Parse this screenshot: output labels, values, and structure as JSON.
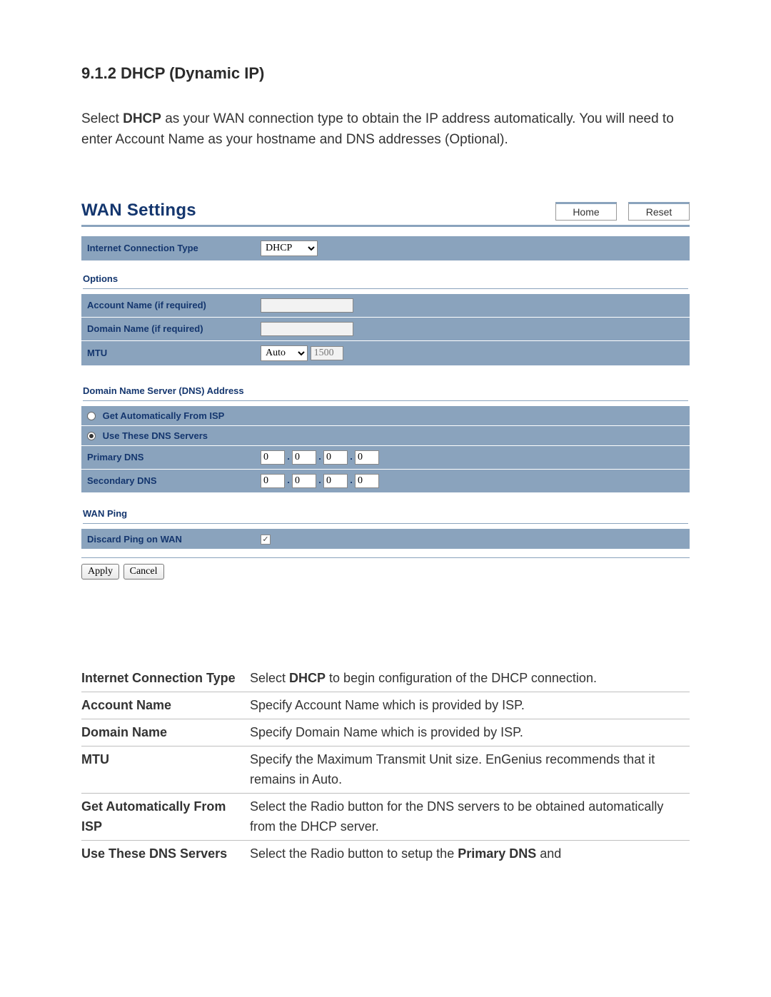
{
  "heading": "9.1.2 DHCP (Dynamic IP)",
  "intro_pre": "Select ",
  "intro_bold": "DHCP",
  "intro_post": " as your WAN connection type to obtain the IP address automatically. You will need to enter Account Name as your hostname and DNS addresses (Optional).",
  "panel": {
    "title": "WAN Settings",
    "home": "Home",
    "reset": "Reset",
    "conn_type_label": "Internet Connection Type",
    "conn_type_value": "DHCP",
    "options_heading": "Options",
    "account_label": "Account Name (if required)",
    "account_value": "",
    "domain_label": "Domain Name (if required)",
    "domain_value": "",
    "mtu_label": "MTU",
    "mtu_mode": "Auto",
    "mtu_value": "1500",
    "dns_heading": "Domain Name Server (DNS) Address",
    "dns_auto_label": "Get Automatically From ISP",
    "dns_manual_label": "Use These DNS Servers",
    "primary_label": "Primary DNS",
    "secondary_label": "Secondary DNS",
    "primary": [
      "0",
      "0",
      "0",
      "0"
    ],
    "secondary": [
      "0",
      "0",
      "0",
      "0"
    ],
    "wanping_heading": "WAN Ping",
    "discard_label": "Discard Ping on WAN",
    "apply": "Apply",
    "cancel": "Cancel"
  },
  "desc": [
    {
      "key": "Internet Connection Type",
      "pre": "Select ",
      "bold": "DHCP",
      "post": " to begin configuration of the DHCP connection."
    },
    {
      "key": "Account Name",
      "pre": "Specify Account Name which is provided by ISP.",
      "bold": "",
      "post": ""
    },
    {
      "key": "Domain Name",
      "pre": "Specify Domain Name which is provided by ISP.",
      "bold": "",
      "post": ""
    },
    {
      "key": "MTU",
      "pre": "Specify the Maximum Transmit Unit size. EnGenius recommends that it remains in Auto.",
      "bold": "",
      "post": ""
    },
    {
      "key": "Get Automatically From ISP",
      "pre": "Select the Radio button for the DNS servers to be obtained automatically from the DHCP server.",
      "bold": "",
      "post": ""
    },
    {
      "key": "Use These DNS Servers",
      "pre": "Select the Radio button to setup the ",
      "bold": "Primary DNS",
      "post": " and"
    }
  ]
}
